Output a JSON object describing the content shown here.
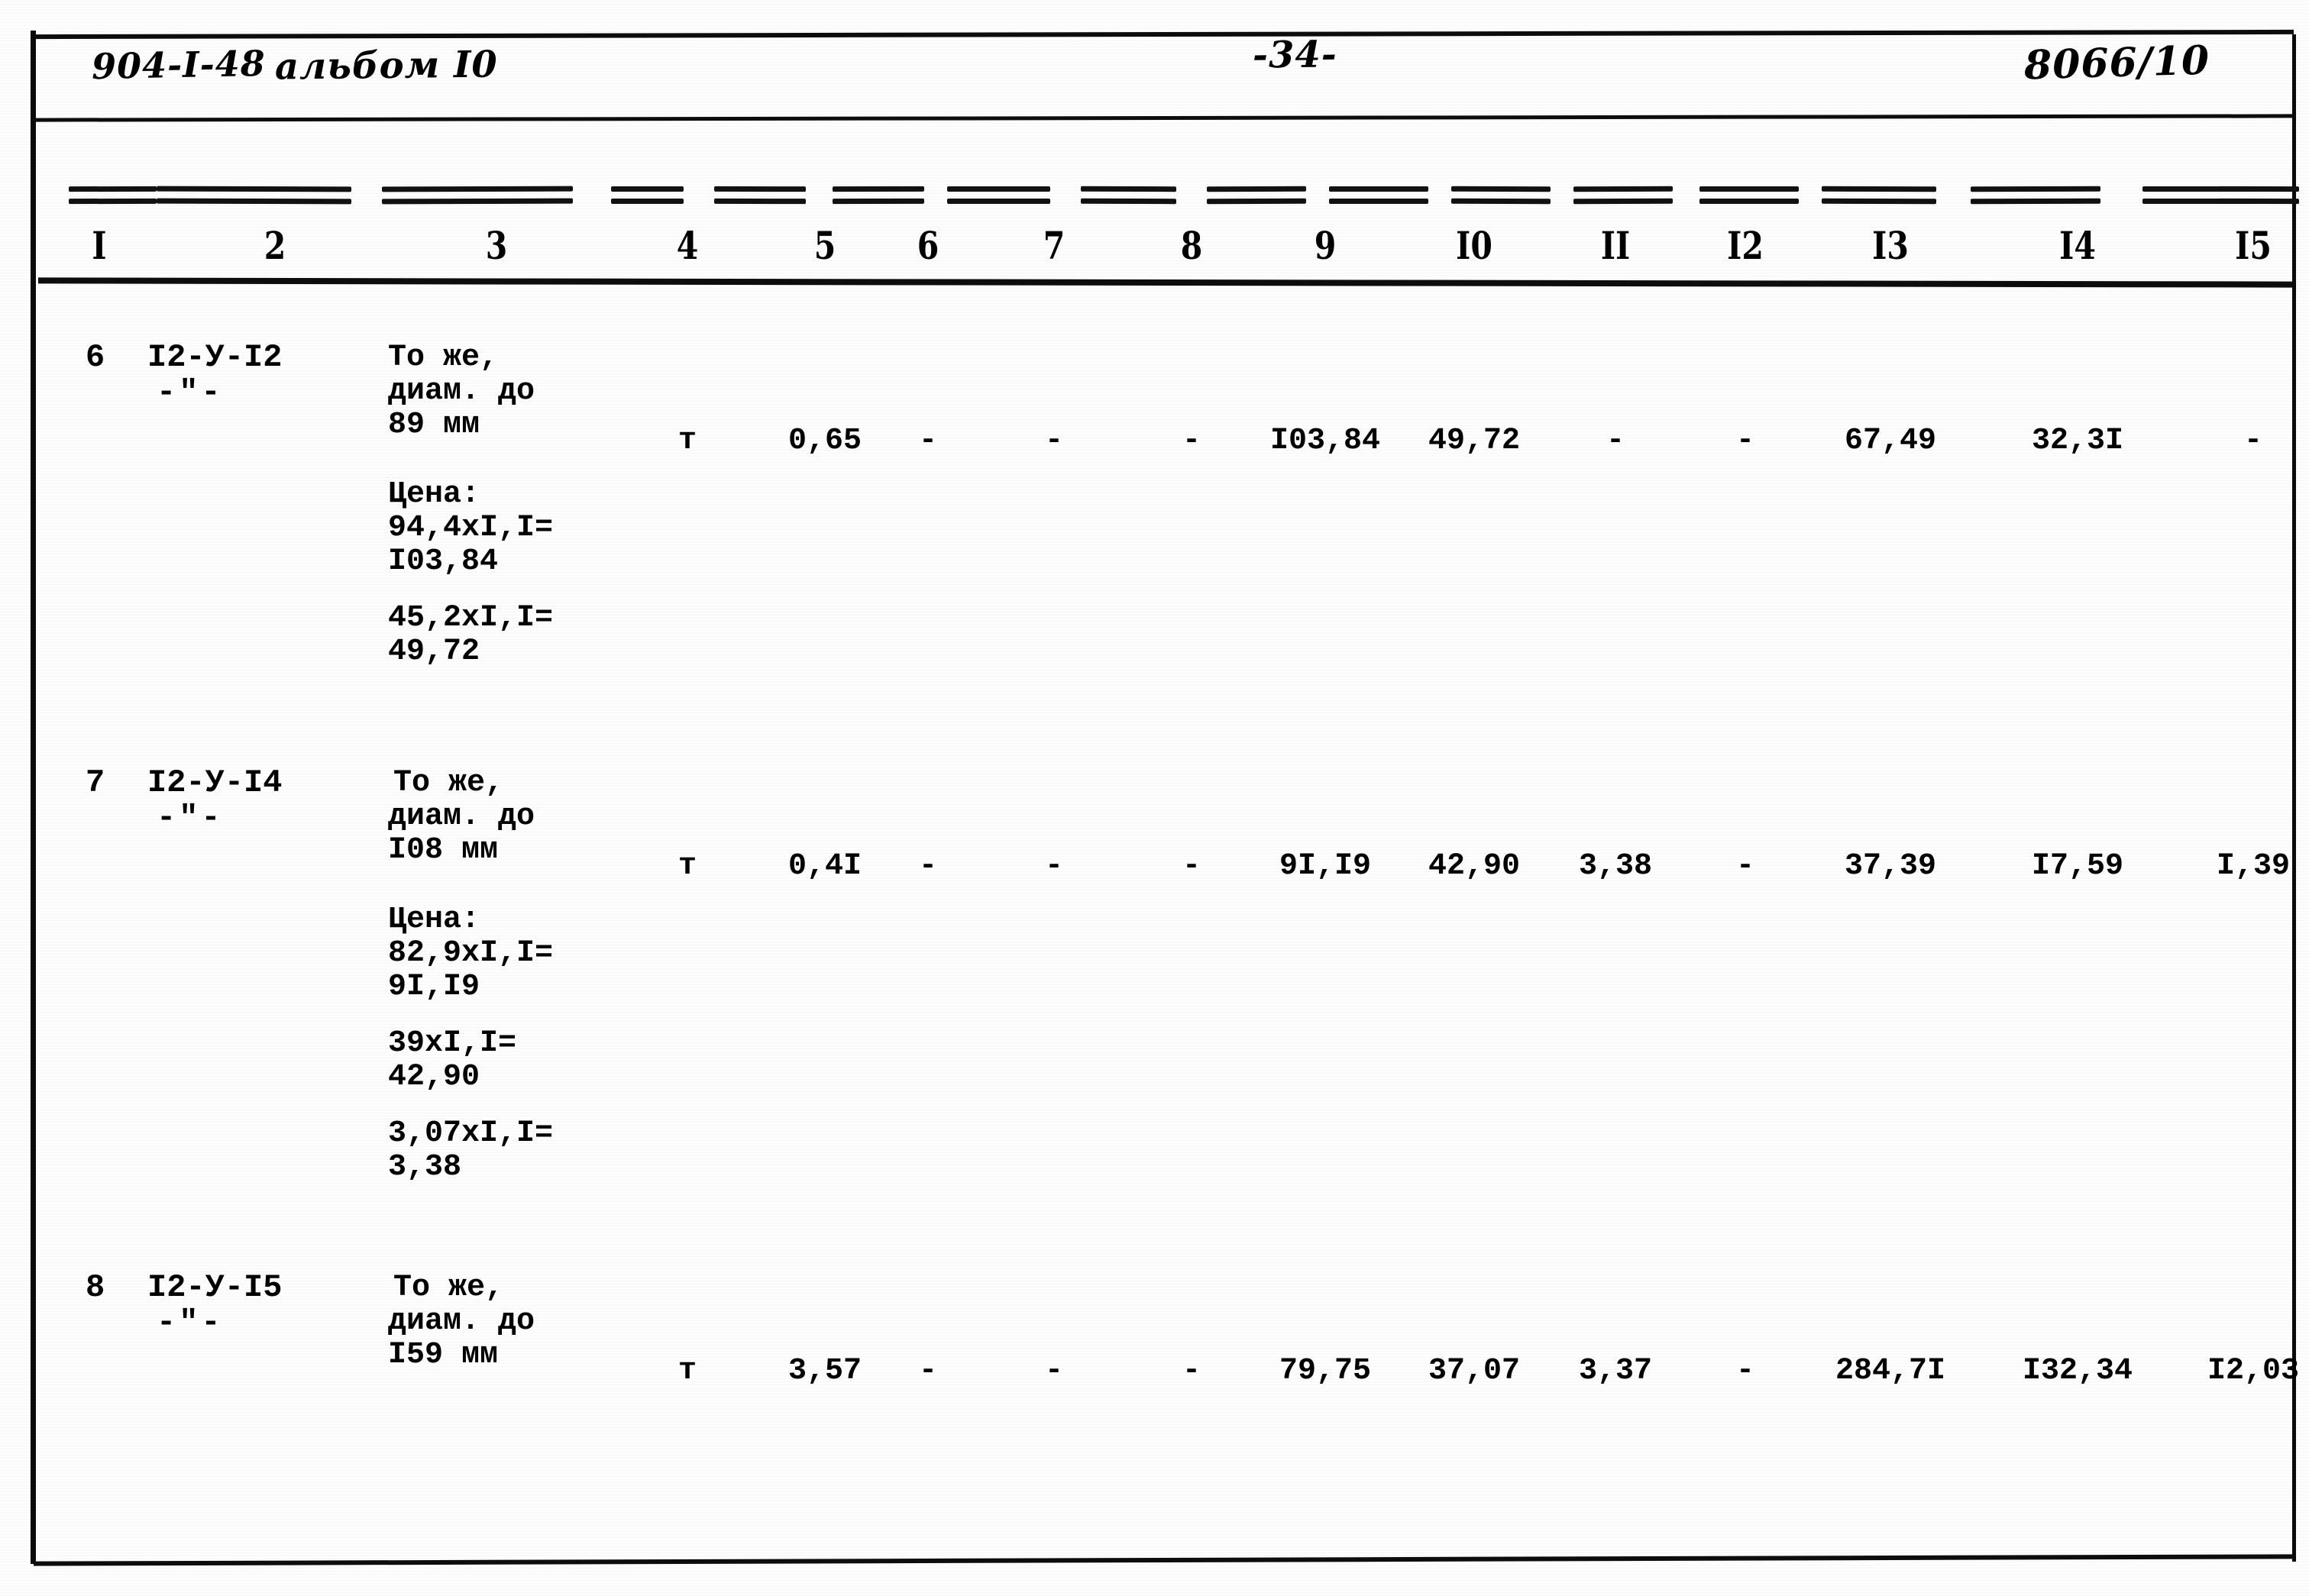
{
  "header": {
    "doc_code": "904-I-48",
    "album_label": "альбом I0",
    "page_number": "-34-",
    "doc_ref": "8066/10"
  },
  "table": {
    "column_numbers": [
      "I",
      "2",
      "3",
      "4",
      "5",
      "6",
      "7",
      "8",
      "9",
      "I0",
      "II",
      "I2",
      "I3",
      "I4",
      "I5"
    ],
    "rows": [
      {
        "row_number": "6",
        "code": "I2-У-I2",
        "ditto": "-\"-",
        "description_line1": "То же,",
        "description_line2": "диам. до",
        "description_line3": "89 мм",
        "price_title": "Цена:",
        "price_lines": [
          "94,4xI,I=",
          "I03,84",
          "45,2xI,I=",
          "49,72"
        ],
        "unit": "т",
        "c5": "0,65",
        "c6": "-",
        "c7": "-",
        "c8": "-",
        "c9": "I03,84",
        "c10": "49,72",
        "c11": "-",
        "c12": "-",
        "c13": "67,49",
        "c14": "32,3I",
        "c15": "-"
      },
      {
        "row_number": "7",
        "code": "I2-У-I4",
        "ditto": "-\"-",
        "description_line1": "То же,",
        "description_line2": "диам. до",
        "description_line3": "I08 мм",
        "price_title": "Цена:",
        "price_lines": [
          "82,9xI,I=",
          "9I,I9",
          "39xI,I=",
          "42,90",
          "3,07xI,I=",
          "3,38"
        ],
        "unit": "т",
        "c5": "0,4I",
        "c6": "-",
        "c7": "-",
        "c8": "-",
        "c9": "9I,I9",
        "c10": "42,90",
        "c11": "3,38",
        "c12": "-",
        "c13": "37,39",
        "c14": "I7,59",
        "c15": "I,39"
      },
      {
        "row_number": "8",
        "code": "I2-У-I5",
        "ditto": "-\"-",
        "description_line1": "То же,",
        "description_line2": "диам. до",
        "description_line3": "I59 мм",
        "price_title": "",
        "price_lines": [],
        "unit": "т",
        "c5": "3,57",
        "c6": "-",
        "c7": "-",
        "c8": "-",
        "c9": "79,75",
        "c10": "37,07",
        "c11": "3,37",
        "c12": "-",
        "c13": "284,7I",
        "c14": "I32,34",
        "c15": "I2,03"
      }
    ]
  }
}
